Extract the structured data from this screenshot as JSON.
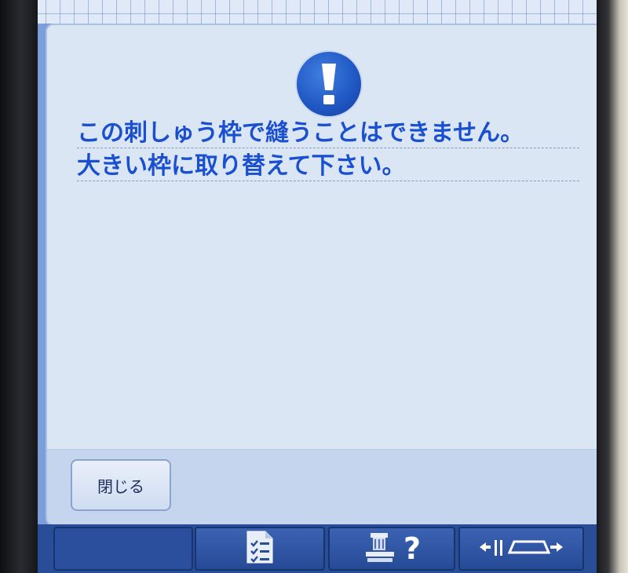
{
  "dialog": {
    "message_lines": [
      "この刺しゅう枠で縫うことはできません。",
      "大きい枠に取り替えて下さい。"
    ],
    "close_label": "閉じる"
  },
  "toolbar": {
    "buttons": [
      "checklist-icon",
      "help-icon",
      "frame-move-icon"
    ],
    "help_label": "?",
    "frame_label": "←ii▭→"
  },
  "colors": {
    "message_text": "#1a4fd0",
    "alert_icon": "#1f56c2",
    "dialog_bg": "#dbe6f5",
    "toolbar_bg": "#2a4d98"
  }
}
